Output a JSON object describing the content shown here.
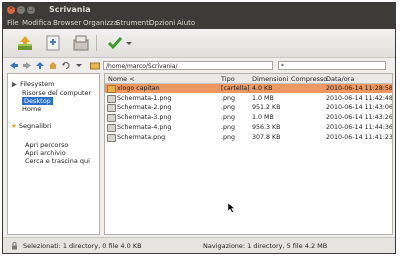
{
  "window": {
    "title": "Scrivania"
  },
  "menu": [
    "File",
    "Modifica",
    "Browser",
    "Organizza",
    "Strumenti",
    "Opzioni",
    "Aiuto"
  ],
  "toolbar": {
    "icons": [
      "extract-icon",
      "add-icon",
      "archive-icon",
      "check-icon",
      "dropdown-icon"
    ]
  },
  "location": {
    "path": "/home/marco/Scrivania/",
    "filter": "*"
  },
  "sidebar": {
    "filesystem_label": "Filesystem",
    "items": [
      "Risorse del computer",
      "Desktop",
      "Home"
    ],
    "bookmarks_label": "Segnalibri",
    "actions": [
      "Apri percorso",
      "Apri archivio",
      "Cerca e trascina qui"
    ]
  },
  "columns": [
    "Nome <",
    "Tipo",
    "Dimensioni",
    "Compresso",
    "Data/ora"
  ],
  "files": [
    {
      "name": "xlogo capitan",
      "type": "[cartella]",
      "size": "4.0 KB",
      "compressed": "",
      "date": "2010-06-14 11:28:58",
      "selected": true
    },
    {
      "name": "Schermata-1.png",
      "type": ".png",
      "size": "1.0 MB",
      "compressed": "",
      "date": "2010-06-14 11:42:48",
      "selected": false
    },
    {
      "name": "Schermata-2.png",
      "type": ".png",
      "size": "951.2 KB",
      "compressed": "",
      "date": "2010-06-14 11:43:06",
      "selected": false
    },
    {
      "name": "Schermata-3.png",
      "type": ".png",
      "size": "1.0 MB",
      "compressed": "",
      "date": "2010-06-14 11:43:26",
      "selected": false
    },
    {
      "name": "Schermata-4.png",
      "type": ".png",
      "size": "956.3 KB",
      "compressed": "",
      "date": "2010-06-14 11:44:36",
      "selected": false
    },
    {
      "name": "Schermata.png",
      "type": ".png",
      "size": "307.8 KB",
      "compressed": "",
      "date": "2010-06-14 11:41:23",
      "selected": false
    }
  ],
  "status": {
    "left": "Selezionati: 1 directory, 0 file 4.0 KB",
    "right": "Navigazione: 1 directory, 5 file 4.2 MB"
  },
  "colors": {
    "accent": "#eb9862",
    "selection": "#2d6fc7",
    "titlebar": "#3c3b37",
    "close": "#e0653a"
  }
}
